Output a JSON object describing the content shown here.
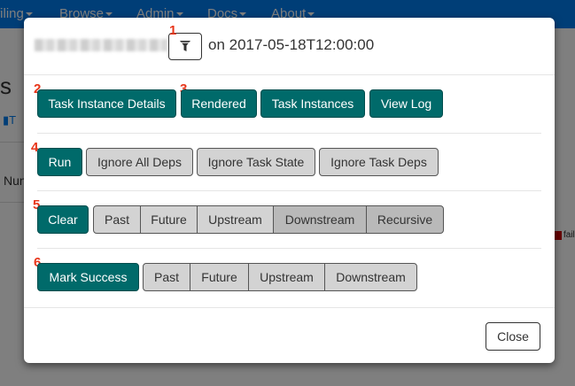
{
  "nav": {
    "items": [
      "filing",
      "Browse",
      "Admin",
      "Docs",
      "About"
    ]
  },
  "background": {
    "heading_fragment": "s",
    "tab_fragment": "T",
    "row_fragment": "Nun",
    "legend_fragment": "fail"
  },
  "modal": {
    "header_date": "on 2017-05-18T12:00:00",
    "filter_icon": "filter-icon",
    "row1": {
      "task_instance_details": "Task Instance Details",
      "rendered": "Rendered",
      "task_instances": "Task Instances",
      "view_log": "View Log"
    },
    "row2": {
      "run": "Run",
      "ignore_all_deps": "Ignore All Deps",
      "ignore_task_state": "Ignore Task State",
      "ignore_task_deps": "Ignore Task Deps"
    },
    "row3": {
      "clear": "Clear",
      "past": "Past",
      "future": "Future",
      "upstream": "Upstream",
      "downstream": "Downstream",
      "recursive": "Recursive"
    },
    "row4": {
      "mark_success": "Mark Success",
      "past": "Past",
      "future": "Future",
      "upstream": "Upstream",
      "downstream": "Downstream"
    },
    "close": "Close"
  },
  "badges": [
    "1",
    "2",
    "3",
    "4",
    "5",
    "6"
  ],
  "colors": {
    "navbar": "#017cee",
    "primary_button": "#006a6a",
    "default_button": "#d3d3d3",
    "badge": "#e8361b"
  }
}
